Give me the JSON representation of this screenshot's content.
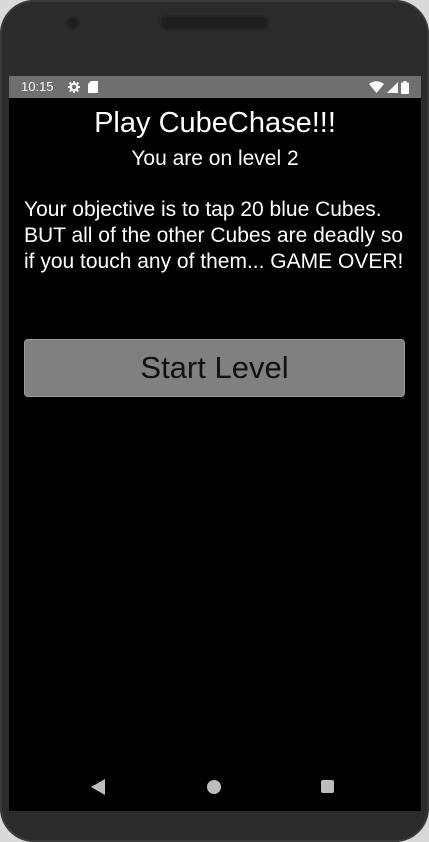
{
  "status_bar": {
    "time": "10:15",
    "icons_left": [
      "settings-icon",
      "sd-card-icon"
    ],
    "icons_right": [
      "wifi-icon",
      "cell-signal-icon",
      "battery-icon"
    ]
  },
  "main": {
    "title": "Play CubeChase!!!",
    "level_text": "You are on level 2",
    "objective": "Your objective is to tap 20 blue Cubes. BUT all of the other Cubes are deadly so if you touch any of them... GAME OVER!",
    "start_button_label": "Start Level"
  },
  "nav_bar": {
    "buttons": [
      "back",
      "home",
      "recents"
    ]
  },
  "colors": {
    "screen_background": "#000000",
    "status_bar": "#6f6f6f",
    "button_background": "#808080",
    "text": "#ffffff"
  }
}
